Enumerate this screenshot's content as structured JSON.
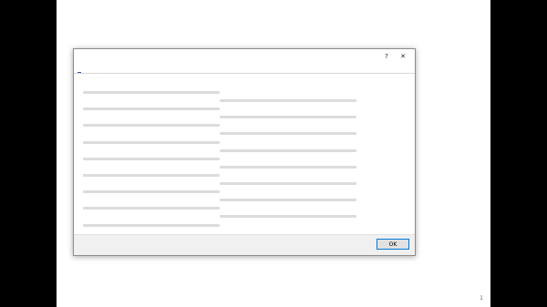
{
  "slide": {
    "page_number": "1"
  },
  "dialog": {
    "title": "",
    "help_label": "?",
    "close_label": "✕",
    "tabs": [
      {
        "label": ""
      },
      {
        "label": ""
      },
      {
        "label": ""
      },
      {
        "label": ""
      },
      {
        "label": ""
      }
    ],
    "section_heading": "",
    "ok_label": "OK"
  }
}
